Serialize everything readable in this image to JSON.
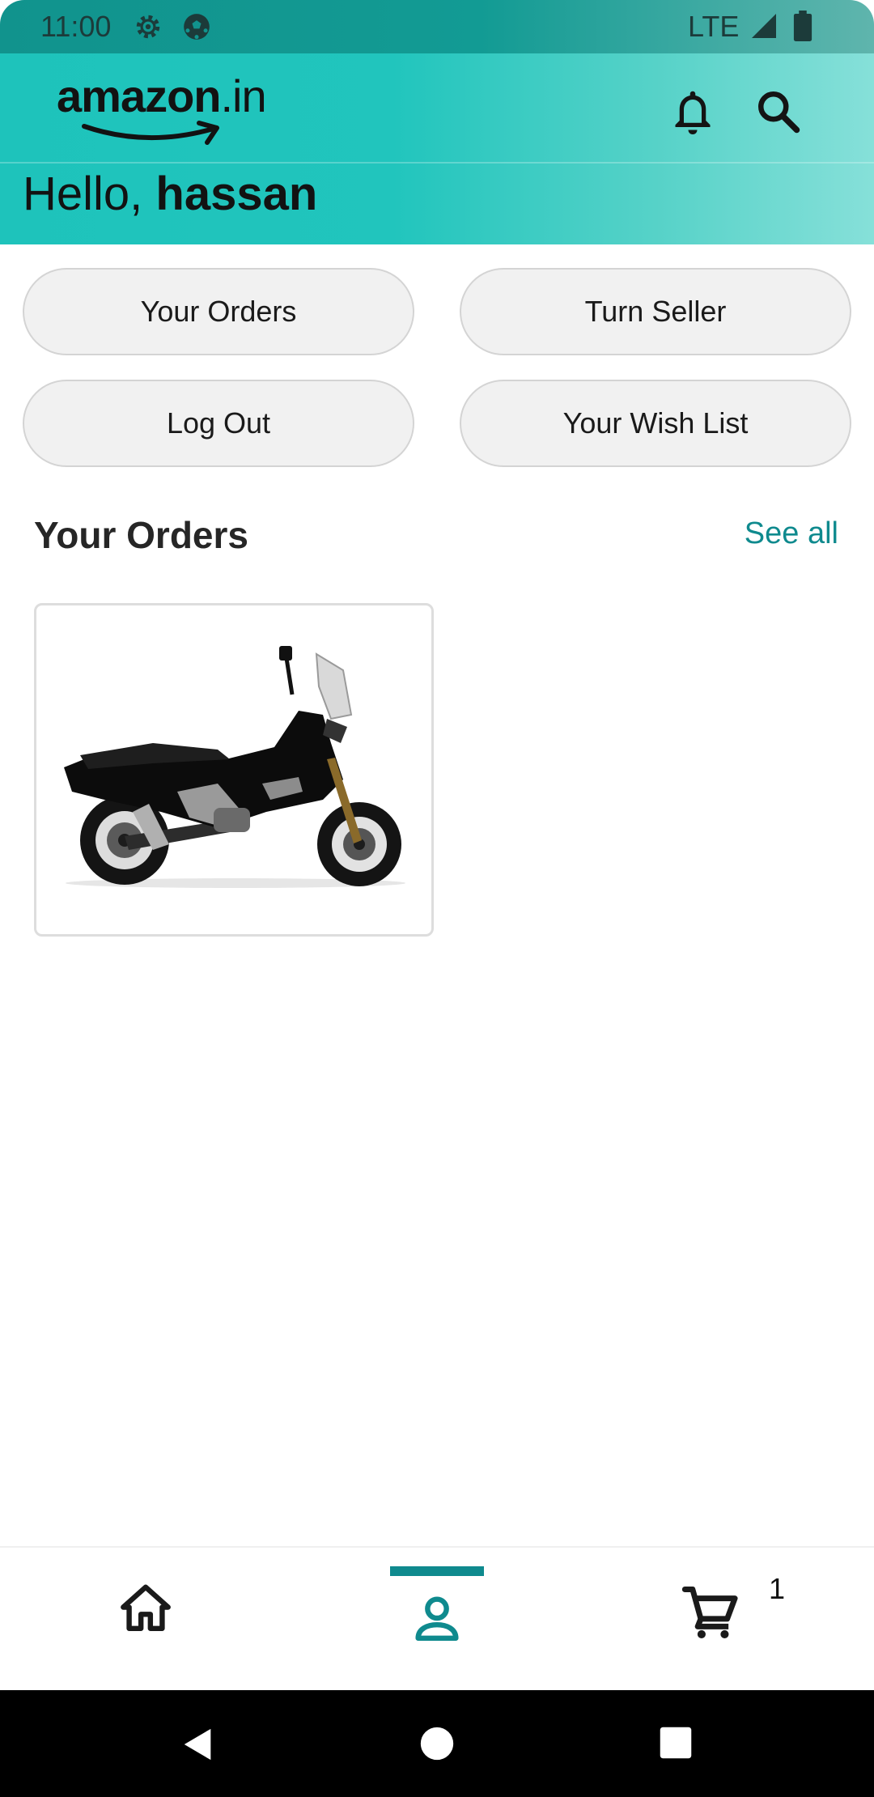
{
  "status_bar": {
    "time": "11:00",
    "network": "LTE",
    "icons": [
      "settings-gear-icon",
      "soccer-ball-icon",
      "signal-icon",
      "battery-icon"
    ]
  },
  "header": {
    "logo": {
      "brand": "amazon",
      "suffix": ".in"
    },
    "greeting_prefix": "Hello, ",
    "user_name": "hassan",
    "icons": [
      "bell-icon",
      "search-icon"
    ]
  },
  "quick_actions": [
    {
      "label": "Your Orders"
    },
    {
      "label": "Turn Seller"
    },
    {
      "label": "Log Out"
    },
    {
      "label": "Your Wish List"
    }
  ],
  "orders_section": {
    "title": "Your Orders",
    "see_all": "See all",
    "items": [
      {
        "image": "motorcycle-scooter"
      }
    ]
  },
  "bottom_nav": {
    "items": [
      "home-icon",
      "account-icon",
      "cart-icon"
    ],
    "active": "account-icon",
    "cart_count": "1"
  },
  "colors": {
    "header_teal": "#1ec3bb",
    "accent": "#0f8a8e",
    "pill_background": "#f1f1f1"
  }
}
